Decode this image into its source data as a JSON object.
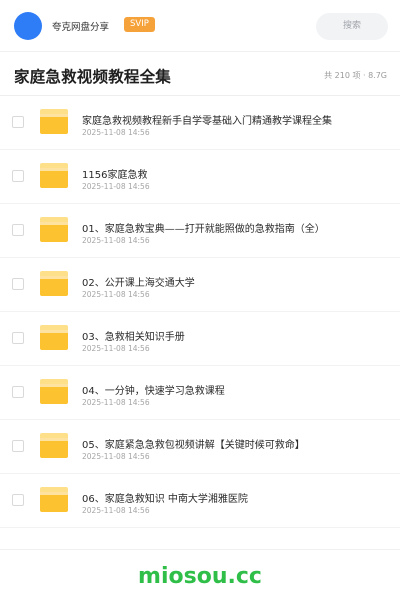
{
  "header": {
    "share_name": "夸克网盘分享",
    "vip_label": "SVIP",
    "search_placeholder": "搜索"
  },
  "title_bar": {
    "title": "家庭急救视频教程全集",
    "summary": "共 210 项 · 8.7G"
  },
  "items": [
    {
      "name": "家庭急救视频教程新手自学零基础入门精通教学课程全集",
      "date": "2025-11-08 14:56"
    },
    {
      "name": "1156家庭急救",
      "date": "2025-11-08 14:56"
    },
    {
      "name": "01、家庭急救宝典——打开就能照做的急救指南（全）",
      "date": "2025-11-08 14:56"
    },
    {
      "name": "02、公开课上海交通大学",
      "date": "2025-11-08 14:56"
    },
    {
      "name": "03、急救相关知识手册",
      "date": "2025-11-08 14:56"
    },
    {
      "name": "04、一分钟，快速学习急救课程",
      "date": "2025-11-08 14:56"
    },
    {
      "name": "05、家庭紧急急救包视频讲解【关键时候可救命】",
      "date": "2025-11-08 14:56"
    },
    {
      "name": "06、家庭急救知识 中南大学湘雅医院",
      "date": "2025-11-08 14:56"
    }
  ],
  "watermark": "miosou.cc",
  "colors": {
    "avatar": "#2f7df6",
    "vip": "#f6a23b",
    "folder": "#fdc22f",
    "watermark": "#2fbf48"
  }
}
